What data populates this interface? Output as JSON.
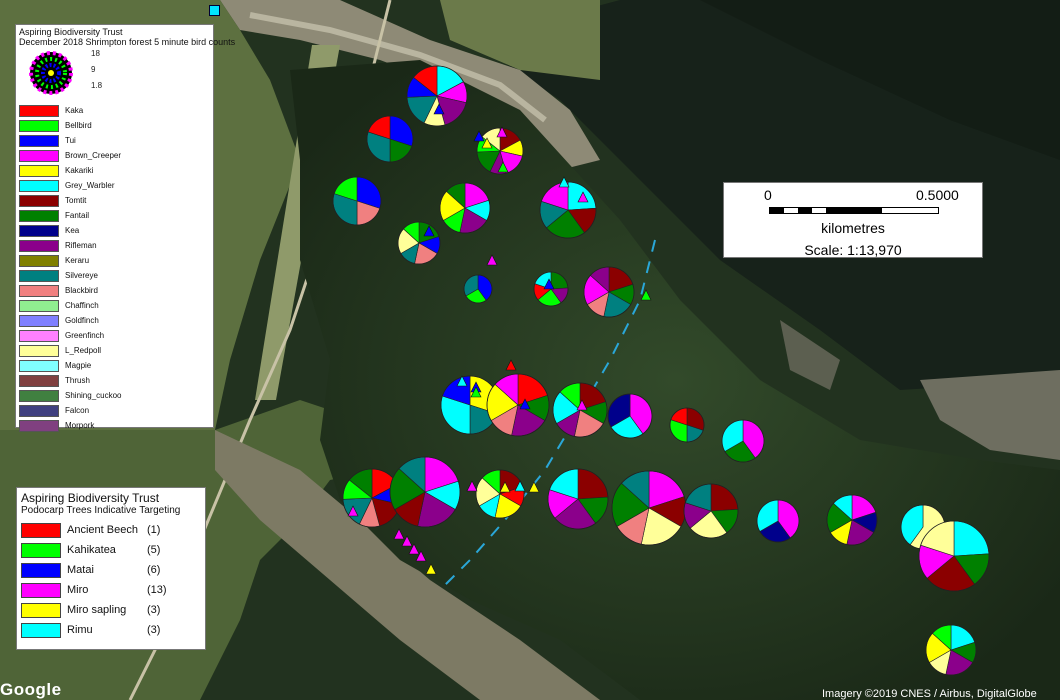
{
  "species_legend": {
    "title": "Aspiring Biodiversity Trust",
    "subtitle": "December 2018 Shrimpton forest 5 minute bird counts",
    "size_scale": [
      "18",
      "9",
      "1.8"
    ],
    "items": [
      {
        "label": "Kaka",
        "color": "#ff0000"
      },
      {
        "label": "Bellbird",
        "color": "#00ff00"
      },
      {
        "label": "Tui",
        "color": "#0000ff"
      },
      {
        "label": "Brown_Creeper",
        "color": "#ff00ff"
      },
      {
        "label": "Kakariki",
        "color": "#ffff00"
      },
      {
        "label": "Grey_Warbler",
        "color": "#00ffff"
      },
      {
        "label": "Tomtit",
        "color": "#8b0000"
      },
      {
        "label": "Fantail",
        "color": "#008000"
      },
      {
        "label": "Kea",
        "color": "#00008b"
      },
      {
        "label": "Rifleman",
        "color": "#8b008b"
      },
      {
        "label": "Keraru",
        "color": "#808000"
      },
      {
        "label": "Silvereye",
        "color": "#008080"
      },
      {
        "label": "Blackbird",
        "color": "#f08080"
      },
      {
        "label": "Chaffinch",
        "color": "#90ee90"
      },
      {
        "label": "Goldfinch",
        "color": "#8080ff"
      },
      {
        "label": "Greenfinch",
        "color": "#ff80ff"
      },
      {
        "label": "L_Redpoll",
        "color": "#ffff99"
      },
      {
        "label": "Magpie",
        "color": "#80ffff"
      },
      {
        "label": "Thrush",
        "color": "#804040"
      },
      {
        "label": "Shining_cuckoo",
        "color": "#408040"
      },
      {
        "label": "Falcon",
        "color": "#404080"
      },
      {
        "label": "Morpork",
        "color": "#804080"
      }
    ]
  },
  "tree_legend": {
    "title": "Aspiring Biodiversity Trust",
    "subtitle": "Podocarp Trees Indicative Targeting",
    "items": [
      {
        "label": "Ancient Beech",
        "count": "(1)",
        "color": "#ff0000"
      },
      {
        "label": "Kahikatea",
        "count": "(5)",
        "color": "#00ff00"
      },
      {
        "label": "Matai",
        "count": "(6)",
        "color": "#0000ff"
      },
      {
        "label": "Miro",
        "count": "(13)",
        "color": "#ff00ff"
      },
      {
        "label": "Miro sapling",
        "count": "(3)",
        "color": "#ffff00"
      },
      {
        "label": "Rimu",
        "count": "(3)",
        "color": "#00ffff"
      }
    ]
  },
  "scale_bar": {
    "start": "0",
    "end": "0.5000",
    "unit": "kilometres",
    "ratio": "Scale: 1:13,970"
  },
  "basemap": {
    "logo": "Google",
    "attribution": "Imagery ©2019 CNES / Airbus, DigitalGlobe"
  }
}
